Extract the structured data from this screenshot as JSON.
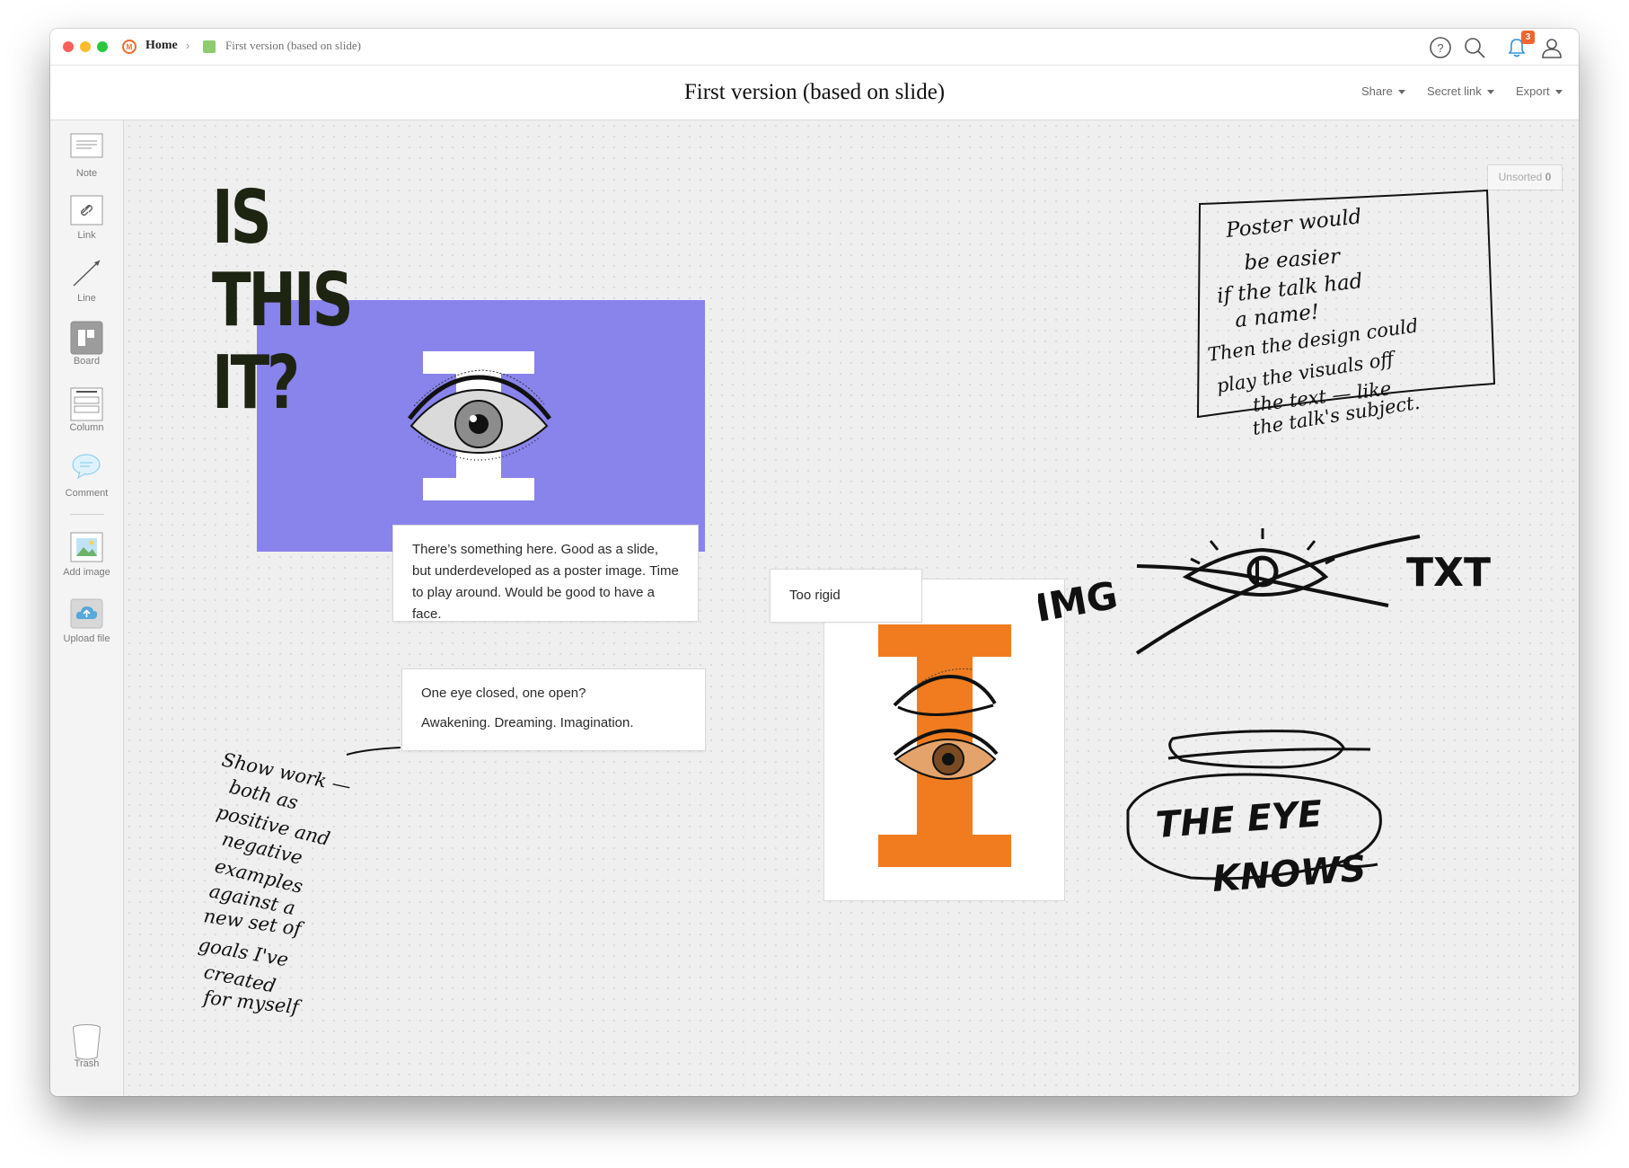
{
  "window": {
    "breadcrumb": {
      "home": "Home",
      "board": "First version (based on slide)"
    },
    "notification_count": "3",
    "icons": [
      "milanote-logo-icon",
      "board-color-icon",
      "help-icon",
      "search-icon",
      "bell-icon",
      "user-icon"
    ]
  },
  "header": {
    "title": "First version (based on slide)",
    "menu": {
      "share": "Share",
      "secret_link": "Secret link",
      "export": "Export"
    }
  },
  "sidebar": {
    "tools": [
      {
        "label": "Note",
        "icon": "note-icon"
      },
      {
        "label": "Link",
        "icon": "link-icon"
      },
      {
        "label": "Line",
        "icon": "line-icon"
      },
      {
        "label": "Board",
        "icon": "board-icon"
      },
      {
        "label": "Column",
        "icon": "column-icon"
      },
      {
        "label": "Comment",
        "icon": "comment-icon"
      },
      {
        "label": "Add image",
        "icon": "image-icon"
      },
      {
        "label": "Upload file",
        "icon": "upload-icon"
      }
    ],
    "trash": {
      "label": "Trash",
      "icon": "trash-icon"
    }
  },
  "canvas": {
    "unsorted": {
      "label": "Unsorted",
      "count": "0"
    },
    "slide_title": [
      "IS",
      "THIS",
      "IT?"
    ],
    "notes": {
      "slide_note": "There’s something here. Good as a slide, but underdeveloped as a poster image. Time to play around. Would be good to have a face.",
      "eye_note_line1": "One eye closed, one open?",
      "eye_note_line2": "Awakening. Dreaming. Imagination.",
      "rigid_note": "Too rigid"
    },
    "sketches": {
      "poster_note": [
        "Poster would",
        "be easier",
        "if the talk had",
        "a name!",
        "Then the design could",
        "play the visuals off",
        "the text — like",
        "the talk's subject."
      ],
      "img_txt": [
        "IMG",
        "TXT"
      ],
      "eye_knows": [
        "THE EYE",
        "KNOWS"
      ],
      "show_work": [
        "Show work —",
        "both as",
        "positive and",
        "negative",
        "examples",
        "against a",
        "new set of",
        "goals I've",
        "created",
        "for myself"
      ]
    },
    "colors": {
      "slide_purple": "#8983ec",
      "poster_orange": "#f07c1f",
      "title_ink": "#1e2412",
      "accent": "#f0642d"
    }
  }
}
